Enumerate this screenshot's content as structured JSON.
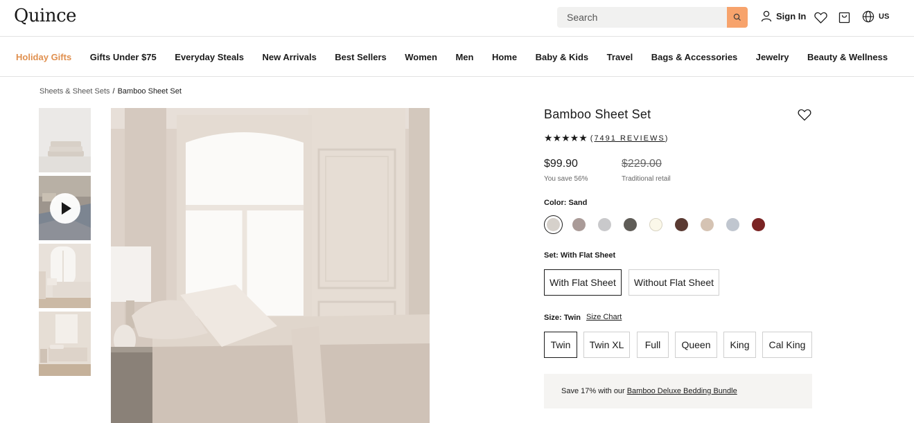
{
  "header": {
    "logo": "Quince",
    "search_placeholder": "Search",
    "sign_in": "Sign In",
    "region": "US"
  },
  "nav": {
    "items": [
      "Holiday Gifts",
      "Gifts Under $75",
      "Everyday Steals",
      "New Arrivals",
      "Best Sellers",
      "Women",
      "Men",
      "Home",
      "Baby & Kids",
      "Travel",
      "Bags & Accessories",
      "Jewelry",
      "Beauty & Wellness"
    ],
    "accent_color": "#e0904f"
  },
  "breadcrumb": {
    "parent": "Sheets & Sheet Sets",
    "separator": "/",
    "current": "Bamboo Sheet Set"
  },
  "product": {
    "title": "Bamboo Sheet Set",
    "rating_stars": "★★★★★",
    "rating_value": 5,
    "reviews_open": "(",
    "reviews_text": "7491 REVIEWS",
    "reviews_close": ")",
    "price": "$99.90",
    "savings": "You save 56%",
    "original_price": "$229.00",
    "original_note": "Traditional retail",
    "color_label": "Color: Sand",
    "colors": [
      {
        "name": "sand",
        "hex": "#d6d1cb",
        "selected": true
      },
      {
        "name": "mauve",
        "hex": "#aa9b98"
      },
      {
        "name": "light-grey",
        "hex": "#c9c9cb"
      },
      {
        "name": "charcoal",
        "hex": "#5f5c57"
      },
      {
        "name": "ivory",
        "hex": "#fbf8e9"
      },
      {
        "name": "chocolate",
        "hex": "#5a3a32"
      },
      {
        "name": "blush",
        "hex": "#d5c3b3"
      },
      {
        "name": "sky",
        "hex": "#c0c6cf"
      },
      {
        "name": "burgundy",
        "hex": "#7a2424"
      }
    ],
    "set_label": "Set: With Flat Sheet",
    "set_options": [
      "With Flat Sheet",
      "Without Flat Sheet"
    ],
    "size_label": "Size: Twin",
    "size_chart": "Size Chart",
    "size_options": [
      "Twin",
      "Twin XL",
      "Full",
      "Queen",
      "King",
      "Cal King"
    ],
    "bundle_text": "Save 17% with our",
    "bundle_link": "Bamboo Deluxe Bedding Bundle"
  },
  "icons": {
    "search": "search-icon",
    "user": "user-icon",
    "heart": "heart-icon",
    "cart": "cart-icon",
    "globe": "globe-icon",
    "play": "play-icon"
  },
  "colors": {
    "search_button": "#f7a36c",
    "bundle_bg": "#f5f4f2"
  }
}
